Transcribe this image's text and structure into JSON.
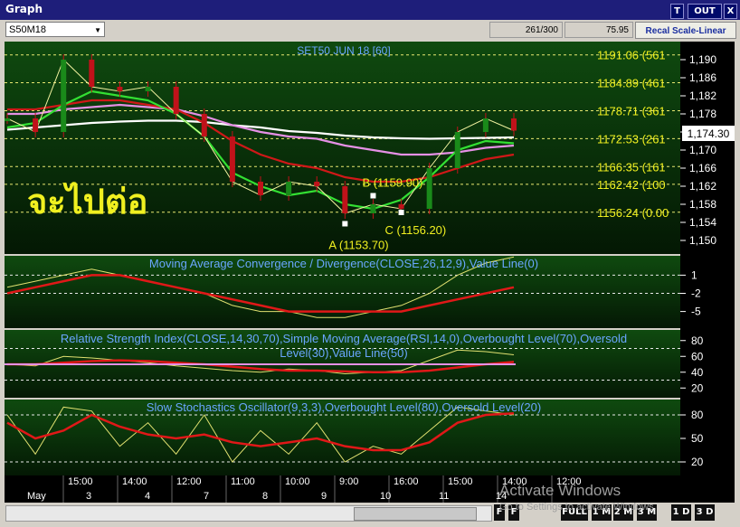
{
  "window": {
    "title": "Graph",
    "buttons": [
      "T",
      "OUT",
      "X"
    ]
  },
  "toolbar": {
    "symbol": "S50M18",
    "field_count": "261/300",
    "field_value": "75.95",
    "recal_label": "Recal Scale-Linear"
  },
  "colors": {
    "background": "#0a2a0a",
    "price_candle": "#c0121a",
    "fast_ma": "#33e033",
    "mid_ma": "#d01818",
    "slow_ma": "#e590e5",
    "long_ma": "#ffffff",
    "macd_line": "#e0e070",
    "text_yellow": "#f0f020",
    "header_blue": "#6aa6ff"
  },
  "thai_overlay": "จะไปต่อ",
  "price_panel": {
    "title": "SET50 JUN 18   [60]",
    "last_price": "1,174.30",
    "ylim": [
      1148,
      1193
    ],
    "y_ticks": [
      "1,190",
      "1,186",
      "1,182",
      "1,178",
      "1,174",
      "1,170",
      "1,166",
      "1,162",
      "1,158",
      "1,154",
      "1,150"
    ],
    "fib_labels": [
      {
        "value": 1191.06,
        "text": "1191.06 (561"
      },
      {
        "value": 1184.89,
        "text": "1184.89 (461"
      },
      {
        "value": 1178.71,
        "text": "1178.71 (361"
      },
      {
        "value": 1172.53,
        "text": "1172.53 (261"
      },
      {
        "value": 1166.35,
        "text": "1166.35 (161"
      },
      {
        "value": 1162.42,
        "text": "1162.42 (100"
      },
      {
        "value": 1156.24,
        "text": "1156.24 (0.00"
      }
    ],
    "annotations": [
      {
        "text": "A (1153.70)",
        "value": 1153.7
      },
      {
        "text": "B (1159.90)",
        "value": 1159.9
      },
      {
        "text": "C (1156.20)",
        "value": 1156.2
      }
    ]
  },
  "macd_panel": {
    "title": "Moving Average Convergence / Divergence(CLOSE,26,12,9),Value Line(0)",
    "y_ticks": [
      "1",
      "-2",
      "-5"
    ]
  },
  "rsi_panel": {
    "title_line1": "Relative Strength Index(CLOSE,14,30,70),Simple Moving Average(RSI,14,0),Overbought Level(70),Oversold",
    "title_line2": "Level(30),Value Line(50)",
    "y_ticks": [
      "80",
      "60",
      "40",
      "20"
    ]
  },
  "stoch_panel": {
    "title": "Slow Stochastics Oscillator(9,3,3),Overbought Level(80),Oversold Level(20)",
    "y_ticks": [
      "80",
      "50",
      "20"
    ]
  },
  "time_axis": {
    "times": [
      "15:00",
      "14:00",
      "12:00",
      "11:00",
      "10:00",
      "9:00",
      "16:00",
      "15:00",
      "14:00",
      "12:00"
    ],
    "dates": [
      "May",
      "3",
      "4",
      "7",
      "8",
      "9",
      "10",
      "11",
      "14"
    ]
  },
  "status_buttons": [
    "F",
    "F",
    "FULL",
    "1 M",
    "2 M",
    "3 M",
    "1 D",
    "3 D"
  ],
  "watermark": {
    "line1": "Activate Windows",
    "line2": "Go to Settings to activate Windows."
  },
  "chart_data": {
    "type": "line",
    "title": "SET50 JUN 18   [60]",
    "x": [
      "15:00",
      "14:00",
      "12:00",
      "11:00",
      "10:00",
      "9:00",
      "16:00",
      "15:00",
      "14:00",
      "12:00"
    ],
    "series": [
      {
        "values": [
          1177,
          1174,
          1190,
          1184,
          1183,
          1184,
          1178,
          1173,
          1163,
          1160,
          1163,
          1162,
          1156,
          1158,
          1157,
          1166,
          1174,
          1177,
          1174.3
        ]
      },
      {
        "values": [
          1175,
          1176,
          1180,
          1183,
          1182,
          1181,
          1178,
          1173,
          1165,
          1162,
          1160,
          1161,
          1158,
          1157,
          1159,
          1164,
          1170,
          1172,
          1171.5
        ]
      },
      {
        "values": [
          1179,
          1179,
          1180,
          1181,
          1181,
          1180,
          1179,
          1176,
          1172,
          1169,
          1167,
          1166,
          1164,
          1163,
          1163,
          1164,
          1166,
          1168,
          1169
        ]
      },
      {
        "values": [
          1178,
          1178,
          1179,
          1179.5,
          1180,
          1179.5,
          1179,
          1177.5,
          1175.5,
          1174,
          1173,
          1172.5,
          1171,
          1170,
          1169,
          1169,
          1169.5,
          1170.5,
          1171
        ]
      },
      {
        "values": [
          1174.5,
          1175,
          1175.5,
          1176,
          1176.3,
          1176.5,
          1176.5,
          1176.2,
          1175.5,
          1175,
          1174.2,
          1173.8,
          1173.2,
          1172.8,
          1172.6,
          1172.5,
          1172.6,
          1172.7,
          1172.8
        ]
      }
    ],
    "xlabel": "",
    "ylabel": "",
    "ylim": [
      1148,
      1193
    ],
    "grid": true
  }
}
